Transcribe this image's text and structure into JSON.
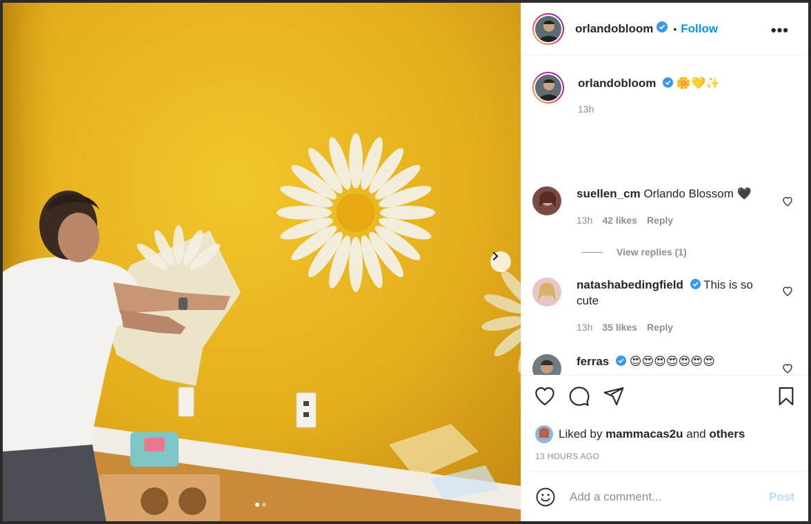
{
  "post": {
    "username": "orlandobloom",
    "follow_label": "Follow",
    "bullet": "•",
    "more_label": "•••",
    "caption_emoji": "🌼💛✨",
    "caption_time": "13h"
  },
  "comments": [
    {
      "username": "suellen_cm",
      "text": "Orlando Blossom 🖤",
      "time": "13h",
      "likes": "42 likes",
      "reply": "Reply",
      "view_replies": "View replies (1)"
    },
    {
      "username": "natashabedingfield",
      "text": "This is so cute",
      "time": "13h",
      "likes": "35 likes",
      "reply": "Reply"
    },
    {
      "username": "ferras",
      "text": "😍😍😍😍😍😍😍"
    }
  ],
  "liked": {
    "prefix": "Liked by",
    "user": "mammacas2u",
    "and": "and",
    "others": "others"
  },
  "timestamp": "13 HOURS AGO",
  "add_comment": {
    "placeholder": "Add a comment...",
    "post_label": "Post"
  },
  "carousel": {
    "current": 1,
    "total": 2
  },
  "colors": {
    "accent": "#0095f6",
    "verified": "#3897f0",
    "wall": "#e9b323"
  },
  "icons": [
    "verified-icon",
    "more-icon",
    "heart-icon",
    "comment-icon",
    "share-icon",
    "bookmark-icon",
    "emoji-icon",
    "chevron-right-icon"
  ]
}
